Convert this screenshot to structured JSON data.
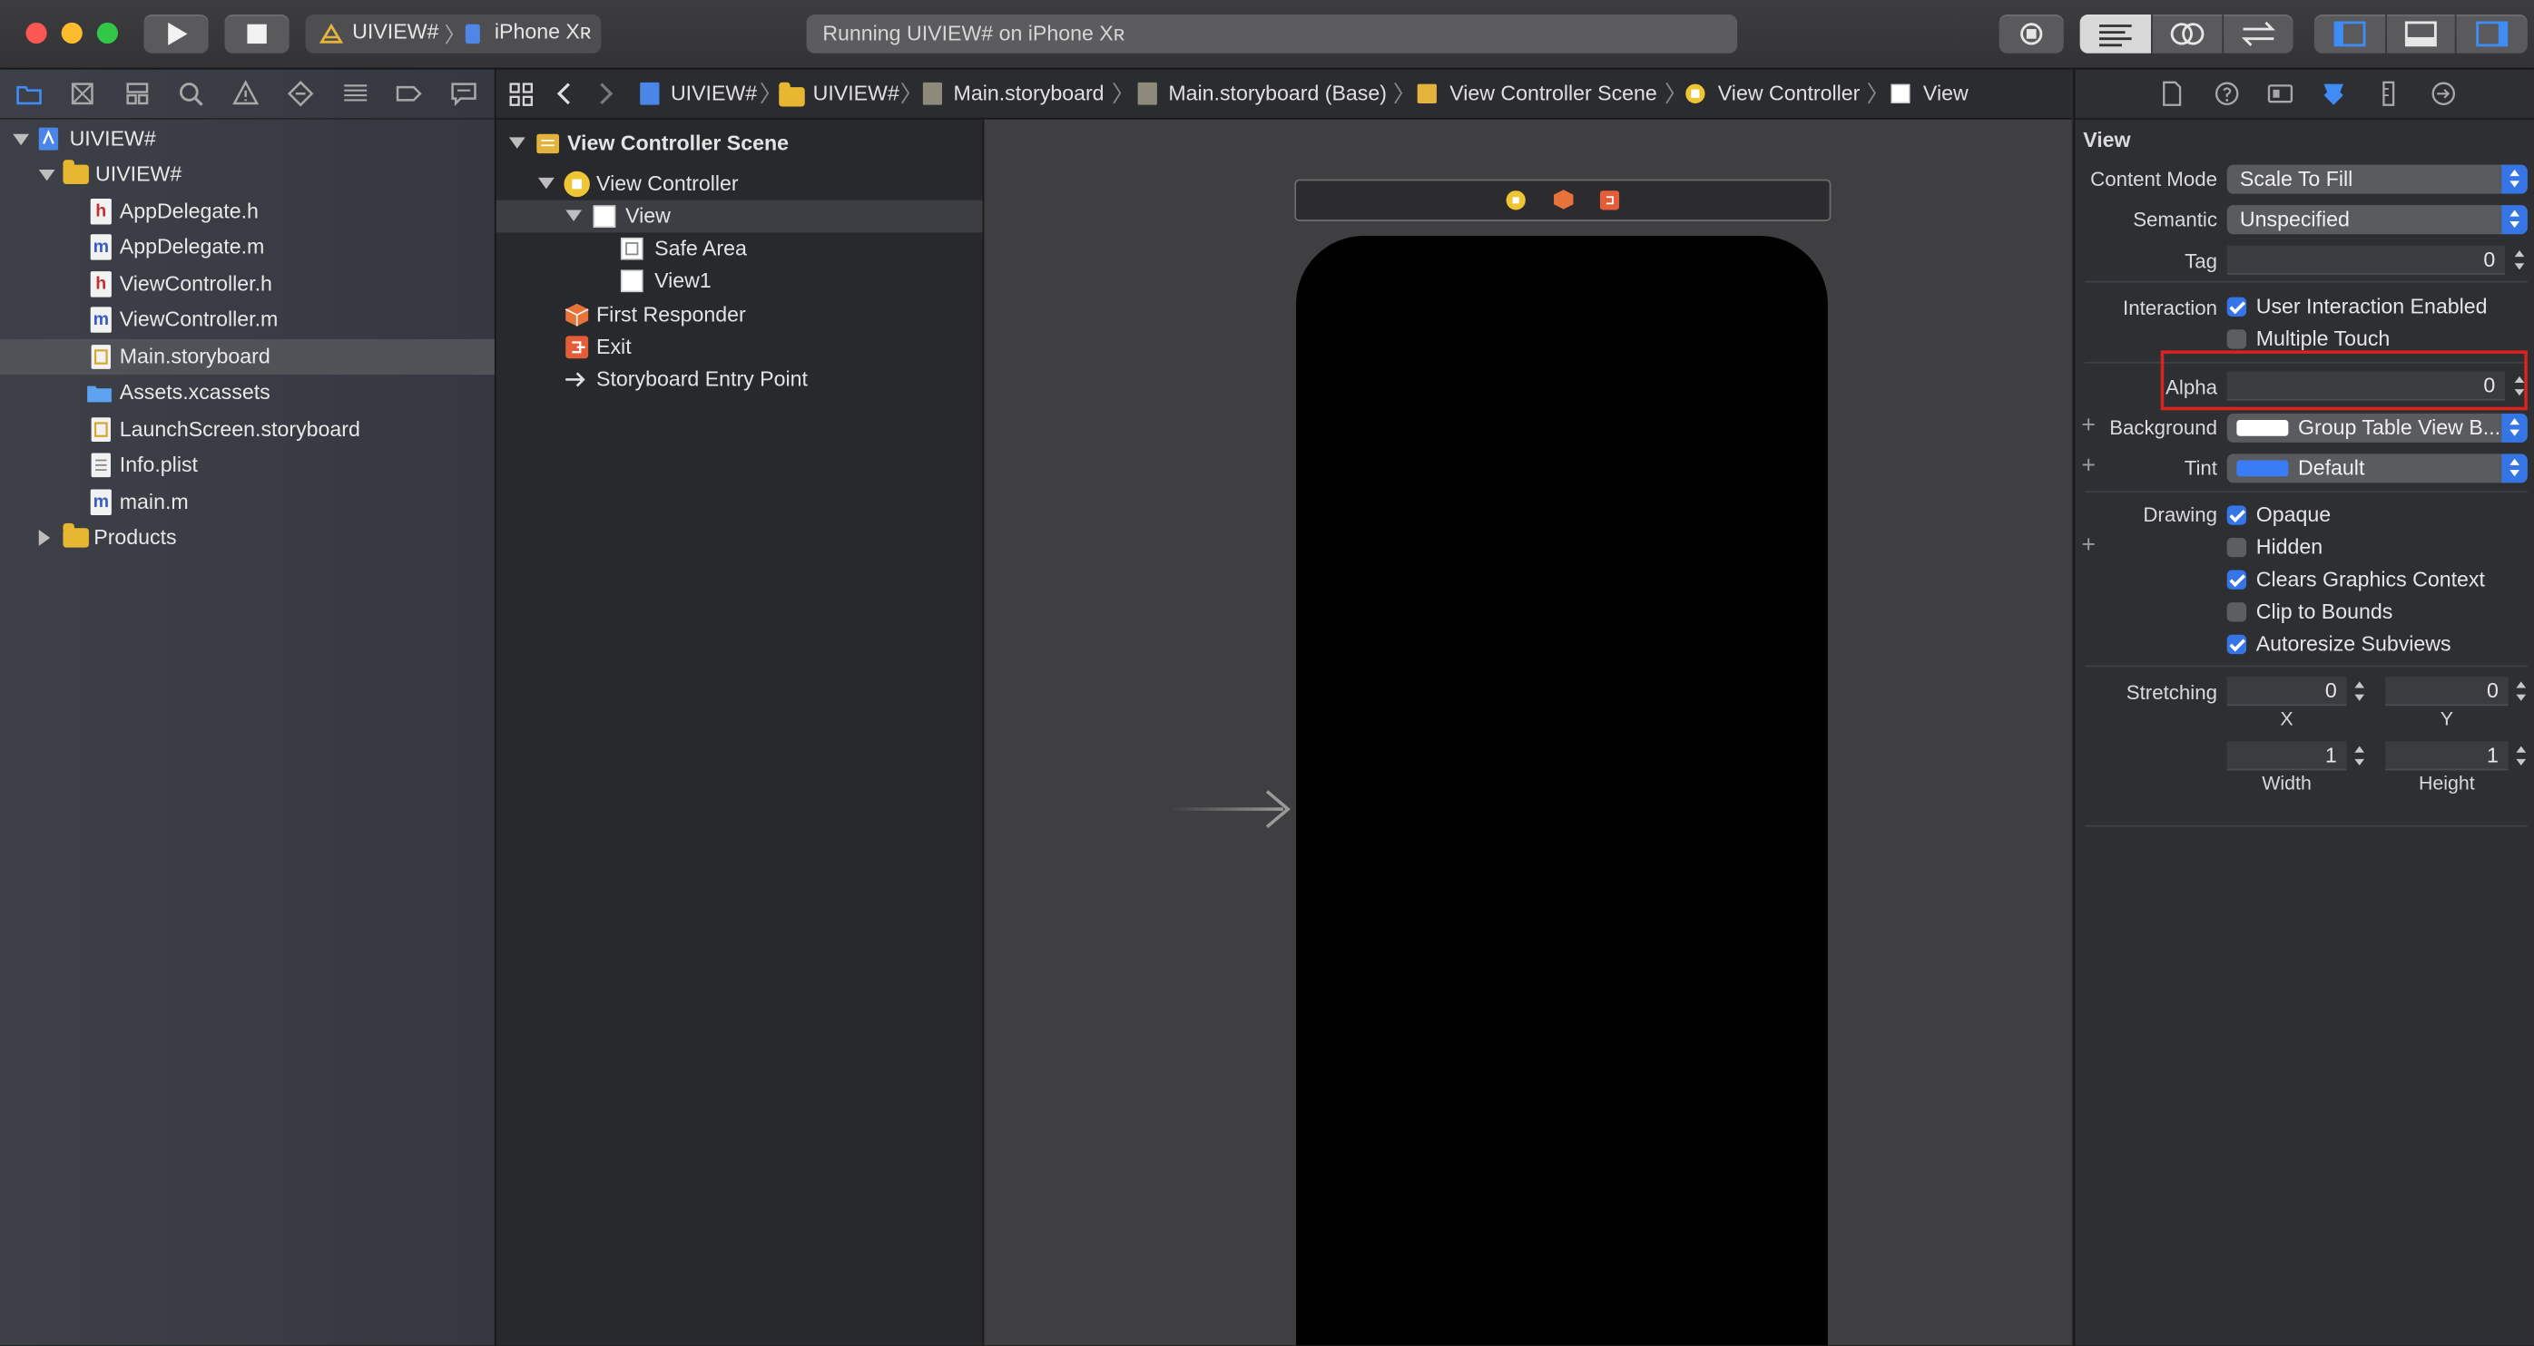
{
  "toolbar": {
    "scheme": {
      "target": "UIVIEW#",
      "device": "iPhone Xʀ"
    },
    "status": "Running UIVIEW# on iPhone Xʀ"
  },
  "navigator": {
    "items": [
      {
        "label": "UIVIEW#",
        "kind": "project"
      },
      {
        "label": "UIVIEW#",
        "kind": "folder"
      },
      {
        "label": "AppDelegate.h",
        "kind": "h"
      },
      {
        "label": "AppDelegate.m",
        "kind": "m"
      },
      {
        "label": "ViewController.h",
        "kind": "h"
      },
      {
        "label": "ViewController.m",
        "kind": "m"
      },
      {
        "label": "Main.storyboard",
        "kind": "storyboard",
        "selected": true
      },
      {
        "label": "Assets.xcassets",
        "kind": "assets"
      },
      {
        "label": "LaunchScreen.storyboard",
        "kind": "storyboard"
      },
      {
        "label": "Info.plist",
        "kind": "plist"
      },
      {
        "label": "main.m",
        "kind": "m"
      },
      {
        "label": "Products",
        "kind": "folder"
      }
    ]
  },
  "jumpbar": {
    "crumbs": [
      "UIVIEW#",
      "UIVIEW#",
      "Main.storyboard",
      "Main.storyboard (Base)",
      "View Controller Scene",
      "View Controller",
      "View"
    ]
  },
  "outline": {
    "items": [
      {
        "label": "View Controller Scene",
        "bold": true
      },
      {
        "label": "View Controller"
      },
      {
        "label": "View",
        "selected": true
      },
      {
        "label": "Safe Area"
      },
      {
        "label": "View1"
      },
      {
        "label": "First Responder"
      },
      {
        "label": "Exit"
      },
      {
        "label": "Storyboard Entry Point"
      }
    ]
  },
  "inspector": {
    "section_title": "View",
    "content_mode": {
      "label": "Content Mode",
      "value": "Scale To Fill"
    },
    "semantic": {
      "label": "Semantic",
      "value": "Unspecified"
    },
    "tag": {
      "label": "Tag",
      "value": "0"
    },
    "interaction": {
      "label": "Interaction",
      "options": [
        {
          "label": "User Interaction Enabled",
          "checked": true
        },
        {
          "label": "Multiple Touch",
          "checked": false
        }
      ]
    },
    "alpha": {
      "label": "Alpha",
      "value": "0"
    },
    "background": {
      "label": "Background",
      "value": "Group Table View B...",
      "swatch": "#ffffff"
    },
    "tint": {
      "label": "Tint",
      "value": "Default",
      "swatch": "#3a7cf6"
    },
    "drawing": {
      "label": "Drawing",
      "options": [
        {
          "label": "Opaque",
          "checked": true
        },
        {
          "label": "Hidden",
          "checked": false
        },
        {
          "label": "Clears Graphics Context",
          "checked": true
        },
        {
          "label": "Clip to Bounds",
          "checked": false
        },
        {
          "label": "Autoresize Subviews",
          "checked": true
        }
      ]
    },
    "stretching": {
      "label": "Stretching",
      "x": {
        "caption": "X",
        "value": "0"
      },
      "y": {
        "caption": "Y",
        "value": "0"
      },
      "width": {
        "caption": "Width",
        "value": "1"
      },
      "height": {
        "caption": "Height",
        "value": "1"
      }
    }
  },
  "colors": {
    "accent": "#3675e6",
    "highlight": "#d8231f"
  }
}
